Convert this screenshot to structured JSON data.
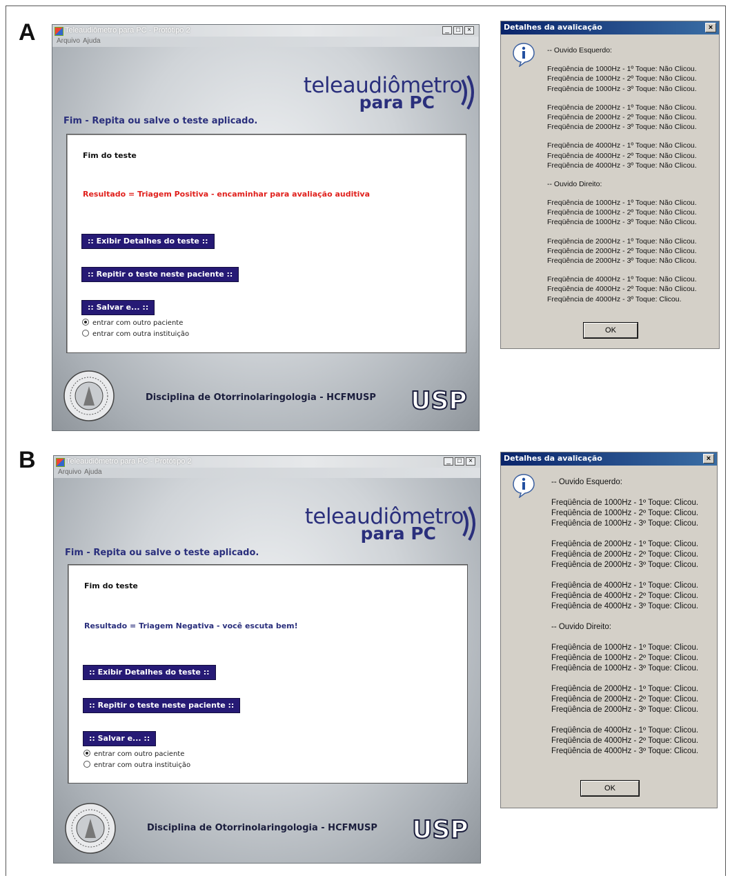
{
  "panels": [
    {
      "letter": "A",
      "window": {
        "title": "Teleaudiômetro para PC - Protótipo 2",
        "menu": [
          "Arquivo",
          "Ajuda"
        ],
        "controls": {
          "minimize": "_",
          "maximize": "□",
          "close": "×"
        },
        "logo_main": "teleaudiômetro",
        "logo_sub": "para PC",
        "subtitle": "Fim - Repita ou salve o teste aplicado.",
        "fim_label": "Fim do teste",
        "result_text": "Resultado = Triagem Positiva - encaminhar para avaliação auditiva",
        "result_color": "#e0201c",
        "buttons": [
          ":: Exibir Detalhes do teste ::",
          ":: Repitir o teste neste paciente ::",
          ":: Salvar e... ::"
        ],
        "radio_options": [
          {
            "label": "entrar com outro paciente",
            "selected": true
          },
          {
            "label": "entrar com outra instituição",
            "selected": false
          }
        ],
        "footer": "Disciplina de Otorrinolaringologia - HCFMUSP",
        "usp_logo_text": "USP"
      },
      "dialog": {
        "title": "Detalhes da avalicação",
        "close": "×",
        "left_header": "-- Ouvido Esquerdo:",
        "left_groups": [
          [
            "Freqüência de 1000Hz - 1º Toque: Não Clicou.",
            "Freqüência de 1000Hz - 2º Toque: Não Clicou.",
            "Freqüência de 1000Hz - 3º Toque: Não Clicou."
          ],
          [
            "Freqüência de 2000Hz - 1º Toque: Não Clicou.",
            "Freqüência de 2000Hz - 2º Toque: Não Clicou.",
            "Freqüência de 2000Hz - 3º Toque: Não Clicou."
          ],
          [
            "Freqüência de 4000Hz - 1º Toque: Não Clicou.",
            "Freqüência de 4000Hz - 2º Toque: Não Clicou.",
            "Freqüência de 4000Hz - 3º Toque: Não Clicou."
          ]
        ],
        "right_header": "-- Ouvido Direito:",
        "right_groups": [
          [
            "Freqüência de 1000Hz - 1º Toque: Não Clicou.",
            "Freqüência de 1000Hz - 2º Toque: Não Clicou.",
            "Freqüência de 1000Hz - 3º Toque: Não Clicou."
          ],
          [
            "Freqüência de 2000Hz - 1º Toque: Não Clicou.",
            "Freqüência de 2000Hz - 2º Toque: Não Clicou.",
            "Freqüência de 2000Hz - 3º Toque: Não Clicou."
          ],
          [
            "Freqüência de 4000Hz - 1º Toque: Não Clicou.",
            "Freqüência de 4000Hz - 2º Toque: Não Clicou.",
            "Freqüência de 4000Hz - 3º Toque: Clicou."
          ]
        ],
        "ok_label": "OK"
      }
    },
    {
      "letter": "B",
      "window": {
        "title": "Teleaudiômetro para PC - Protótipo 2",
        "menu": [
          "Arquivo",
          "Ajuda"
        ],
        "controls": {
          "minimize": "_",
          "maximize": "□",
          "close": "×"
        },
        "logo_main": "teleaudiômetro",
        "logo_sub": "para PC",
        "subtitle": "Fim - Repita ou salve o teste aplicado.",
        "fim_label": "Fim do teste",
        "result_text": "Resultado = Triagem Negativa - você escuta bem!",
        "result_color": "#2a2f7c",
        "buttons": [
          ":: Exibir Detalhes do teste ::",
          ":: Repitir o teste neste paciente ::",
          ":: Salvar e... ::"
        ],
        "radio_options": [
          {
            "label": "entrar com outro paciente",
            "selected": true
          },
          {
            "label": "entrar com outra instituição",
            "selected": false
          }
        ],
        "footer": "Disciplina de Otorrinolaringologia - HCFMUSP",
        "usp_logo_text": "USP"
      },
      "dialog": {
        "title": "Detalhes da avalicação",
        "close": "×",
        "left_header": "-- Ouvido Esquerdo:",
        "left_groups": [
          [
            "Freqüência de 1000Hz - 1º Toque: Clicou.",
            "Freqüência de 1000Hz - 2º Toque: Clicou.",
            "Freqüência de 1000Hz - 3º Toque: Clicou."
          ],
          [
            "Freqüência de 2000Hz - 1º Toque: Clicou.",
            "Freqüência de 2000Hz - 2º Toque: Clicou.",
            "Freqüência de 2000Hz - 3º Toque: Clicou."
          ],
          [
            "Freqüência de 4000Hz - 1º Toque: Clicou.",
            "Freqüência de 4000Hz - 2º Toque: Clicou.",
            "Freqüência de 4000Hz - 3º Toque: Clicou."
          ]
        ],
        "right_header": "-- Ouvido Direito:",
        "right_groups": [
          [
            "Freqüência de 1000Hz - 1º Toque: Clicou.",
            "Freqüência de 1000Hz - 2º Toque: Clicou.",
            "Freqüência de 1000Hz - 3º Toque: Clicou."
          ],
          [
            "Freqüência de 2000Hz - 1º Toque: Clicou.",
            "Freqüência de 2000Hz - 2º Toque: Clicou.",
            "Freqüência de 2000Hz - 3º Toque: Clicou."
          ],
          [
            "Freqüência de 4000Hz - 1º Toque: Clicou.",
            "Freqüência de 4000Hz - 2º Toque: Clicou.",
            "Freqüência de 4000Hz - 3º Toque: Clicou."
          ]
        ],
        "ok_label": "OK"
      }
    }
  ]
}
